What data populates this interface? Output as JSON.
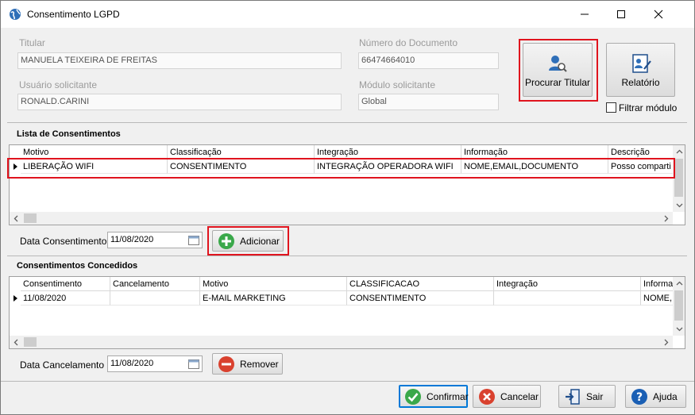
{
  "window": {
    "title": "Consentimento LGPD"
  },
  "header": {
    "titular_label": "Titular",
    "titular_value": "MANUELA TEIXEIRA DE FREITAS",
    "documento_label": "Número do Documento",
    "documento_value": "66474664010",
    "usuario_label": "Usuário solicitante",
    "usuario_value": "RONALD.CARINI",
    "modulo_label": "Módulo solicitante",
    "modulo_value": "Global",
    "procurar_label": "Procurar Titular",
    "relatorio_label": "Relatório",
    "filtrar_label": "Filtrar módulo"
  },
  "lista": {
    "title": "Lista de Consentimentos",
    "columns": [
      "Motivo",
      "Classificação",
      "Integração",
      "Informação",
      "Descrição"
    ],
    "rows": [
      [
        "LIBERAÇÃO WIFI",
        "CONSENTIMENTO",
        "INTEGRAÇÃO OPERADORA WIFI",
        "NOME,EMAIL,DOCUMENTO",
        "Posso comparti"
      ]
    ],
    "date_label": "Data Consentimento",
    "date_value": "11/08/2020",
    "add_label": "Adicionar"
  },
  "concedidos": {
    "title": "Consentimentos Concedidos",
    "columns": [
      "Consentimento",
      "Cancelamento",
      "Motivo",
      "CLASSIFICACAO",
      "Integração",
      "Informa"
    ],
    "rows": [
      [
        "11/08/2020",
        "",
        "E-MAIL MARKETING",
        "CONSENTIMENTO",
        "",
        "NOME,I"
      ]
    ],
    "date_label": "Data Cancelamento",
    "date_value": "11/08/2020",
    "remove_label": "Remover"
  },
  "footer": {
    "confirmar": "Confirmar",
    "cancelar": "Cancelar",
    "sair": "Sair",
    "ajuda": "Ajuda"
  },
  "colors": {
    "highlight_red": "#e0141e",
    "add_green": "#3aa84a",
    "remove_red": "#d9412e",
    "help_blue": "#1a5fb4"
  }
}
